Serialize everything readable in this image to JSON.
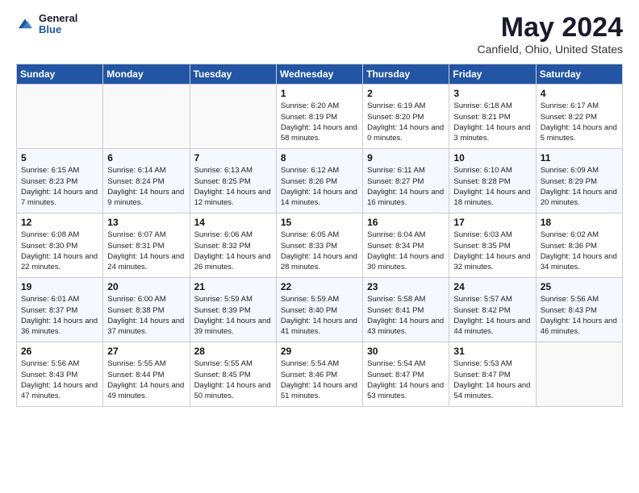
{
  "header": {
    "logo_line1": "General",
    "logo_line2": "Blue",
    "month_year": "May 2024",
    "location": "Canfield, Ohio, United States"
  },
  "days_of_week": [
    "Sunday",
    "Monday",
    "Tuesday",
    "Wednesday",
    "Thursday",
    "Friday",
    "Saturday"
  ],
  "weeks": [
    [
      {
        "date": "",
        "sunrise": "",
        "sunset": "",
        "daylight": "",
        "empty": true
      },
      {
        "date": "",
        "sunrise": "",
        "sunset": "",
        "daylight": "",
        "empty": true
      },
      {
        "date": "",
        "sunrise": "",
        "sunset": "",
        "daylight": "",
        "empty": true
      },
      {
        "date": "1",
        "sunrise": "Sunrise: 6:20 AM",
        "sunset": "Sunset: 8:19 PM",
        "daylight": "Daylight: 14 hours and 58 minutes."
      },
      {
        "date": "2",
        "sunrise": "Sunrise: 6:19 AM",
        "sunset": "Sunset: 8:20 PM",
        "daylight": "Daylight: 14 hours and 0 minutes."
      },
      {
        "date": "3",
        "sunrise": "Sunrise: 6:18 AM",
        "sunset": "Sunset: 8:21 PM",
        "daylight": "Daylight: 14 hours and 3 minutes."
      },
      {
        "date": "4",
        "sunrise": "Sunrise: 6:17 AM",
        "sunset": "Sunset: 8:22 PM",
        "daylight": "Daylight: 14 hours and 5 minutes."
      }
    ],
    [
      {
        "date": "5",
        "sunrise": "Sunrise: 6:15 AM",
        "sunset": "Sunset: 8:23 PM",
        "daylight": "Daylight: 14 hours and 7 minutes."
      },
      {
        "date": "6",
        "sunrise": "Sunrise: 6:14 AM",
        "sunset": "Sunset: 8:24 PM",
        "daylight": "Daylight: 14 hours and 9 minutes."
      },
      {
        "date": "7",
        "sunrise": "Sunrise: 6:13 AM",
        "sunset": "Sunset: 8:25 PM",
        "daylight": "Daylight: 14 hours and 12 minutes."
      },
      {
        "date": "8",
        "sunrise": "Sunrise: 6:12 AM",
        "sunset": "Sunset: 8:26 PM",
        "daylight": "Daylight: 14 hours and 14 minutes."
      },
      {
        "date": "9",
        "sunrise": "Sunrise: 6:11 AM",
        "sunset": "Sunset: 8:27 PM",
        "daylight": "Daylight: 14 hours and 16 minutes."
      },
      {
        "date": "10",
        "sunrise": "Sunrise: 6:10 AM",
        "sunset": "Sunset: 8:28 PM",
        "daylight": "Daylight: 14 hours and 18 minutes."
      },
      {
        "date": "11",
        "sunrise": "Sunrise: 6:09 AM",
        "sunset": "Sunset: 8:29 PM",
        "daylight": "Daylight: 14 hours and 20 minutes."
      }
    ],
    [
      {
        "date": "12",
        "sunrise": "Sunrise: 6:08 AM",
        "sunset": "Sunset: 8:30 PM",
        "daylight": "Daylight: 14 hours and 22 minutes."
      },
      {
        "date": "13",
        "sunrise": "Sunrise: 6:07 AM",
        "sunset": "Sunset: 8:31 PM",
        "daylight": "Daylight: 14 hours and 24 minutes."
      },
      {
        "date": "14",
        "sunrise": "Sunrise: 6:06 AM",
        "sunset": "Sunset: 8:32 PM",
        "daylight": "Daylight: 14 hours and 26 minutes."
      },
      {
        "date": "15",
        "sunrise": "Sunrise: 6:05 AM",
        "sunset": "Sunset: 8:33 PM",
        "daylight": "Daylight: 14 hours and 28 minutes."
      },
      {
        "date": "16",
        "sunrise": "Sunrise: 6:04 AM",
        "sunset": "Sunset: 8:34 PM",
        "daylight": "Daylight: 14 hours and 30 minutes."
      },
      {
        "date": "17",
        "sunrise": "Sunrise: 6:03 AM",
        "sunset": "Sunset: 8:35 PM",
        "daylight": "Daylight: 14 hours and 32 minutes."
      },
      {
        "date": "18",
        "sunrise": "Sunrise: 6:02 AM",
        "sunset": "Sunset: 8:36 PM",
        "daylight": "Daylight: 14 hours and 34 minutes."
      }
    ],
    [
      {
        "date": "19",
        "sunrise": "Sunrise: 6:01 AM",
        "sunset": "Sunset: 8:37 PM",
        "daylight": "Daylight: 14 hours and 36 minutes."
      },
      {
        "date": "20",
        "sunrise": "Sunrise: 6:00 AM",
        "sunset": "Sunset: 8:38 PM",
        "daylight": "Daylight: 14 hours and 37 minutes."
      },
      {
        "date": "21",
        "sunrise": "Sunrise: 5:59 AM",
        "sunset": "Sunset: 8:39 PM",
        "daylight": "Daylight: 14 hours and 39 minutes."
      },
      {
        "date": "22",
        "sunrise": "Sunrise: 5:59 AM",
        "sunset": "Sunset: 8:40 PM",
        "daylight": "Daylight: 14 hours and 41 minutes."
      },
      {
        "date": "23",
        "sunrise": "Sunrise: 5:58 AM",
        "sunset": "Sunset: 8:41 PM",
        "daylight": "Daylight: 14 hours and 43 minutes."
      },
      {
        "date": "24",
        "sunrise": "Sunrise: 5:57 AM",
        "sunset": "Sunset: 8:42 PM",
        "daylight": "Daylight: 14 hours and 44 minutes."
      },
      {
        "date": "25",
        "sunrise": "Sunrise: 5:56 AM",
        "sunset": "Sunset: 8:43 PM",
        "daylight": "Daylight: 14 hours and 46 minutes."
      }
    ],
    [
      {
        "date": "26",
        "sunrise": "Sunrise: 5:56 AM",
        "sunset": "Sunset: 8:43 PM",
        "daylight": "Daylight: 14 hours and 47 minutes."
      },
      {
        "date": "27",
        "sunrise": "Sunrise: 5:55 AM",
        "sunset": "Sunset: 8:44 PM",
        "daylight": "Daylight: 14 hours and 49 minutes."
      },
      {
        "date": "28",
        "sunrise": "Sunrise: 5:55 AM",
        "sunset": "Sunset: 8:45 PM",
        "daylight": "Daylight: 14 hours and 50 minutes."
      },
      {
        "date": "29",
        "sunrise": "Sunrise: 5:54 AM",
        "sunset": "Sunset: 8:46 PM",
        "daylight": "Daylight: 14 hours and 51 minutes."
      },
      {
        "date": "30",
        "sunrise": "Sunrise: 5:54 AM",
        "sunset": "Sunset: 8:47 PM",
        "daylight": "Daylight: 14 hours and 53 minutes."
      },
      {
        "date": "31",
        "sunrise": "Sunrise: 5:53 AM",
        "sunset": "Sunset: 8:47 PM",
        "daylight": "Daylight: 14 hours and 54 minutes."
      },
      {
        "date": "",
        "sunrise": "",
        "sunset": "",
        "daylight": "",
        "empty": true
      }
    ]
  ]
}
